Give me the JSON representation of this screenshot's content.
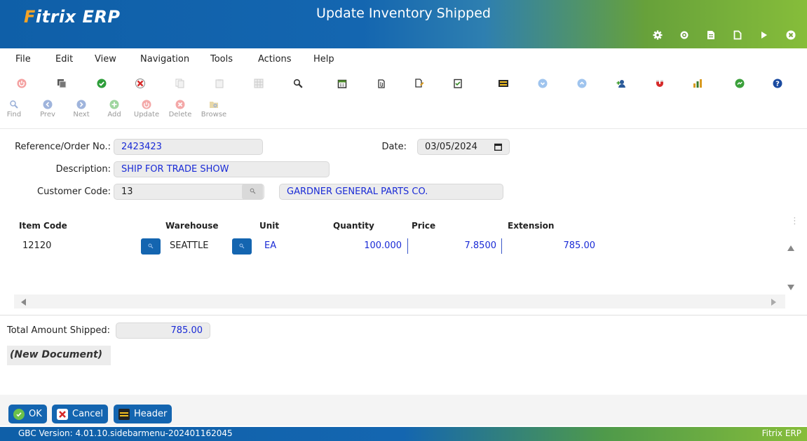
{
  "window": {
    "logo_text": "Fitrix ERP",
    "title": "Update Inventory Shipped"
  },
  "title_icons": [
    "gear-icon",
    "settings-chip-icon",
    "document-icon",
    "new-document-icon",
    "play-icon",
    "close-icon"
  ],
  "menu": {
    "items": [
      "File",
      "Edit",
      "View",
      "Navigation",
      "Tools",
      "Actions",
      "Help"
    ]
  },
  "toolbar1": {
    "icons": [
      "power-icon",
      "copy-window-icon",
      "check-icon",
      "cancel-icon",
      "copy-icon",
      "paste-icon",
      "grid-icon",
      "zoom-icon",
      "calendar-icon",
      "attach-icon",
      "edit-document-icon",
      "notes-icon",
      "header-icon",
      "down-arrow-circle-icon",
      "up-arrow-circle-icon",
      "add-user-icon",
      "magnet-icon",
      "chart-icon",
      "ok-circle-icon",
      "help-icon"
    ]
  },
  "toolbar2": {
    "find": "Find",
    "prev": "Prev",
    "next": "Next",
    "add": "Add",
    "update": "Update",
    "delete": "Delete",
    "browse": "Browse"
  },
  "form": {
    "reference_label": "Reference/Order No.:",
    "reference_value": "2423423",
    "date_label": "Date:",
    "date_value": "03/05/2024",
    "description_label": "Description:",
    "description_value": "SHIP FOR TRADE SHOW",
    "customer_label": "Customer Code:",
    "customer_value": "13",
    "customer_name": "GARDNER GENERAL PARTS CO."
  },
  "grid": {
    "headers": {
      "item_code": "Item Code",
      "warehouse": "Warehouse",
      "unit": "Unit",
      "quantity": "Quantity",
      "price": "Price",
      "extension": "Extension"
    },
    "rows": [
      {
        "item_code": "12120",
        "warehouse": "SEATTLE",
        "unit": "EA",
        "quantity": "100.000",
        "price": "7.8500",
        "extension": "785.00"
      }
    ]
  },
  "totals": {
    "label": "Total Amount Shipped:",
    "value": "785.00"
  },
  "status": {
    "new_document": "(New Document)"
  },
  "actions": {
    "ok": "OK",
    "cancel": "Cancel",
    "header": "Header"
  },
  "footer": {
    "version": "GBC Version: 4.01.10.sidebarmenu-202401162045",
    "brand": "Fitrix ERP"
  },
  "colors": {
    "brand_blue": "#1465b0",
    "brand_green": "#86bd3a",
    "value_blue": "#1a2bd6"
  }
}
